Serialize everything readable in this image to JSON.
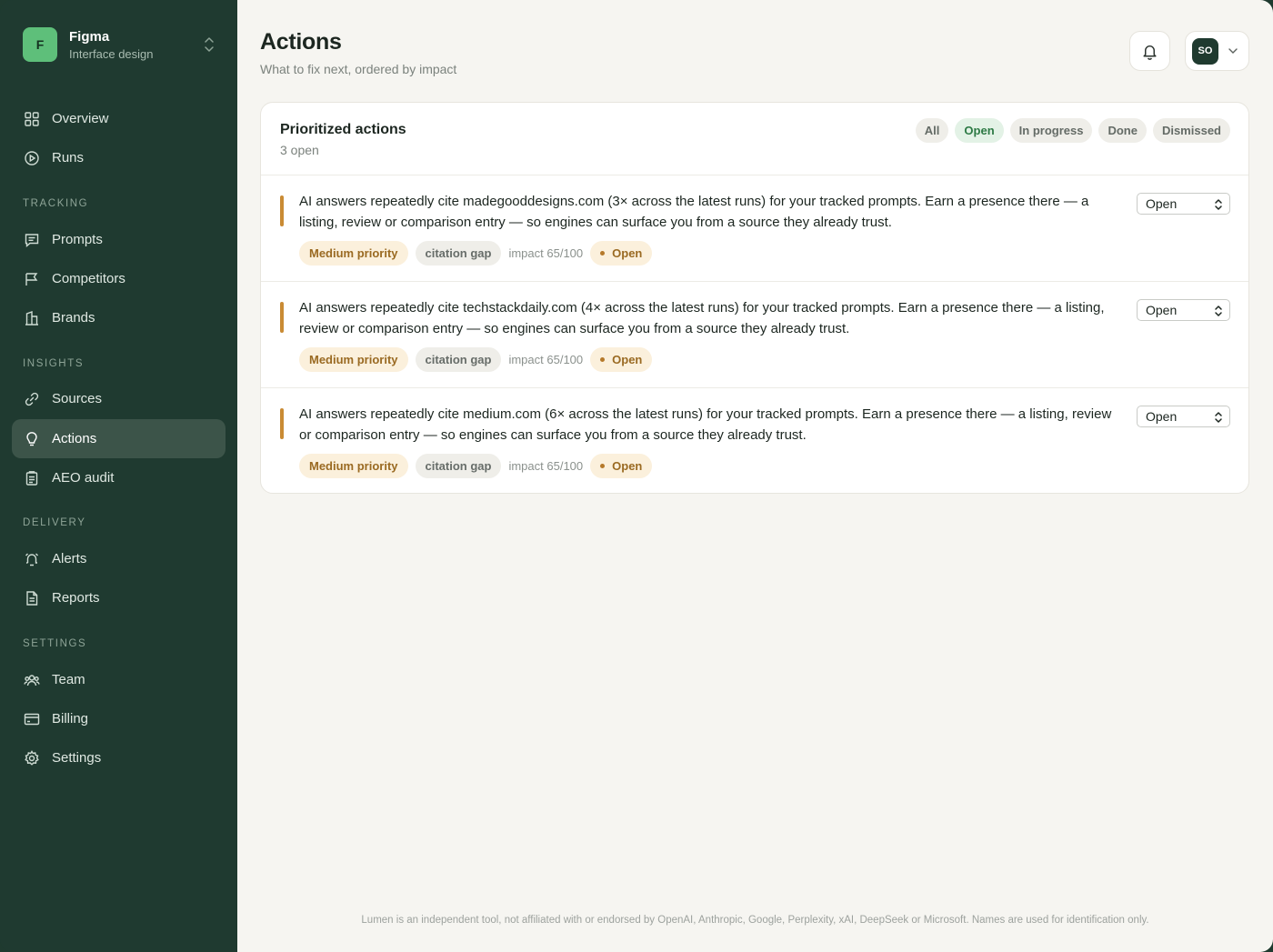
{
  "workspace": {
    "logo_letter": "F",
    "name": "Figma",
    "subtitle": "Interface design"
  },
  "nav": {
    "top": [
      {
        "label": "Overview",
        "icon": "grid-icon"
      },
      {
        "label": "Runs",
        "icon": "play-circle-icon"
      }
    ],
    "tracking_title": "TRACKING",
    "tracking": [
      {
        "label": "Prompts",
        "icon": "message-square-icon"
      },
      {
        "label": "Competitors",
        "icon": "flag-icon"
      },
      {
        "label": "Brands",
        "icon": "building-icon"
      }
    ],
    "insights_title": "INSIGHTS",
    "insights": [
      {
        "label": "Sources",
        "icon": "link-icon"
      },
      {
        "label": "Actions",
        "icon": "lightbulb-icon",
        "active": true
      },
      {
        "label": "AEO audit",
        "icon": "clipboard-icon"
      }
    ],
    "delivery_title": "DELIVERY",
    "delivery": [
      {
        "label": "Alerts",
        "icon": "alarm-icon"
      },
      {
        "label": "Reports",
        "icon": "file-text-icon"
      }
    ],
    "settings_title": "SETTINGS",
    "settings": [
      {
        "label": "Team",
        "icon": "users-icon"
      },
      {
        "label": "Billing",
        "icon": "credit-card-icon"
      },
      {
        "label": "Settings",
        "icon": "gear-icon"
      }
    ]
  },
  "header": {
    "title": "Actions",
    "subtitle": "What to fix next, ordered by impact",
    "user_initials": "SO"
  },
  "card": {
    "title": "Prioritized actions",
    "count": "3 open",
    "filters": [
      {
        "label": "All",
        "selected": false
      },
      {
        "label": "Open",
        "selected": true
      },
      {
        "label": "In progress",
        "selected": false
      },
      {
        "label": "Done",
        "selected": false
      },
      {
        "label": "Dismissed",
        "selected": false
      }
    ],
    "actions": [
      {
        "text": "AI answers repeatedly cite madegooddesigns.com (3× across the latest runs) for your tracked prompts. Earn a presence there — a listing, review or comparison entry — so engines can surface you from a source they already trust.",
        "priority": "Medium priority",
        "category": "citation gap",
        "impact": "impact 65/100",
        "status": "Open",
        "select_value": "Open"
      },
      {
        "text": "AI answers repeatedly cite techstackdaily.com (4× across the latest runs) for your tracked prompts. Earn a presence there — a listing, review or comparison entry — so engines can surface you from a source they already trust.",
        "priority": "Medium priority",
        "category": "citation gap",
        "impact": "impact 65/100",
        "status": "Open",
        "select_value": "Open"
      },
      {
        "text": "AI answers repeatedly cite medium.com (6× across the latest runs) for your tracked prompts. Earn a presence there — a listing, review or comparison entry — so engines can surface you from a source they already trust.",
        "priority": "Medium priority",
        "category": "citation gap",
        "impact": "impact 65/100",
        "status": "Open",
        "select_value": "Open"
      }
    ]
  },
  "footer": "Lumen is an independent tool, not affiliated with or endorsed by OpenAI, Anthropic, Google, Perplexity, xAI, DeepSeek or Microsoft. Names are used for identification only.",
  "colors": {
    "sidebar_bg": "#1f3a30",
    "accent_green": "#5ebf7a",
    "priority_amber": "#c98b34",
    "page_bg": "#f6f5f1"
  }
}
